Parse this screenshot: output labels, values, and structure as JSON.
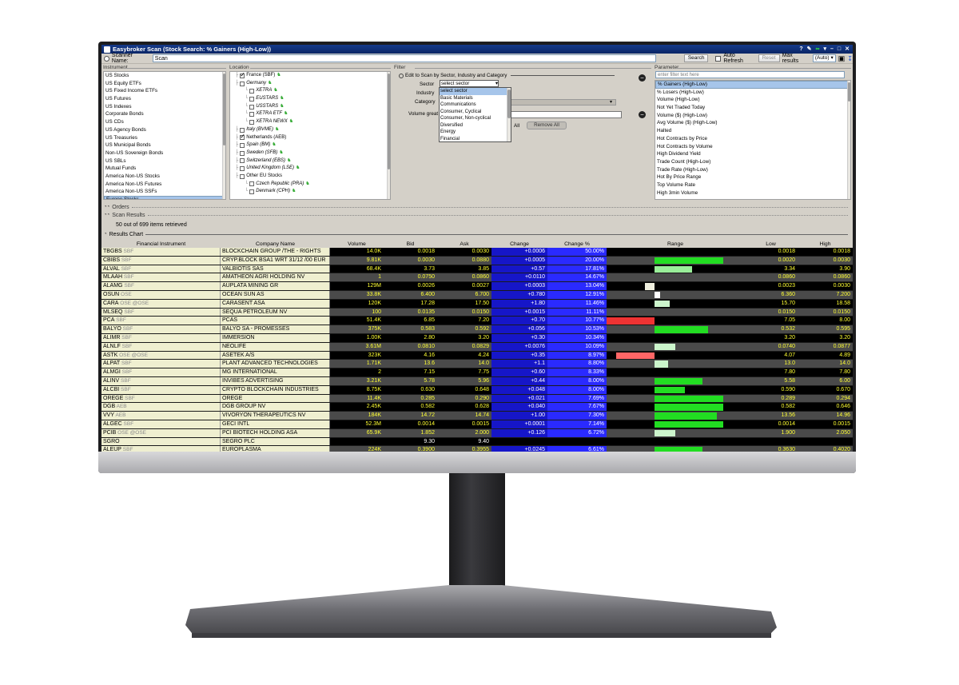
{
  "window": {
    "title": "Easybroker  Scan (Stock Search: % Gainers (High-Low))"
  },
  "scanner": {
    "label": "Scanner Name:",
    "name": "Scan",
    "search_label": "Search",
    "auto_refresh_label": "Auto Refresh",
    "reset_label": "Reset",
    "max_results_label": "Max results",
    "max_results_value": "(Auto)"
  },
  "instrument": {
    "title": "Instrument",
    "items": [
      "US Stocks",
      "US Equity ETFs",
      "US Fixed Income ETFs",
      "US Futures",
      "US Indexes",
      "Corporate Bonds",
      "US CDs",
      "US Agency Bonds",
      "US Treasuries",
      "US Municipal Bonds",
      "Non-US Sovereign Bonds",
      "US SBLs",
      "Mutual Funds",
      "America Non-US Stocks",
      "America Non-US Futures",
      "America Non-US SSFs",
      "Europe Stocks"
    ]
  },
  "location": {
    "title": "Location",
    "items": [
      {
        "label": "France (SBF)",
        "checked": true,
        "indent": 1,
        "italic": false,
        "flag": true
      },
      {
        "label": "Germany",
        "checked": false,
        "indent": 1,
        "italic": true,
        "flag": true
      },
      {
        "label": "XETRA",
        "checked": false,
        "indent": 2,
        "italic": true,
        "flag": true
      },
      {
        "label": "EUSTARS",
        "checked": false,
        "indent": 2,
        "italic": true,
        "flag": true
      },
      {
        "label": "USSTARS",
        "checked": false,
        "indent": 2,
        "italic": true,
        "flag": true
      },
      {
        "label": "XETRA ETF",
        "checked": false,
        "indent": 2,
        "italic": true,
        "flag": true
      },
      {
        "label": "XETRA NEWX",
        "checked": false,
        "indent": 2,
        "italic": true,
        "flag": true
      },
      {
        "label": "Italy (BVME)",
        "checked": false,
        "indent": 1,
        "italic": true,
        "flag": true
      },
      {
        "label": "Netherlands (AEB)",
        "checked": true,
        "indent": 1,
        "italic": false,
        "flag": false
      },
      {
        "label": "Spain (BM)",
        "checked": false,
        "indent": 1,
        "italic": true,
        "flag": true
      },
      {
        "label": "Sweden (SFB)",
        "checked": false,
        "indent": 1,
        "italic": true,
        "flag": true
      },
      {
        "label": "Switzerland (EBS)",
        "checked": false,
        "indent": 1,
        "italic": true,
        "flag": true
      },
      {
        "label": "United Kingdom (LSE)",
        "checked": false,
        "indent": 1,
        "italic": true,
        "flag": true
      },
      {
        "label": "Other EU Stocks",
        "checked": false,
        "indent": 1,
        "italic": false,
        "flag": false
      },
      {
        "label": "Czech Republic (PRA)",
        "checked": false,
        "indent": 2,
        "italic": true,
        "flag": true
      },
      {
        "label": "Denmark (CPH)",
        "checked": false,
        "indent": 2,
        "italic": true,
        "flag": true
      }
    ]
  },
  "filter": {
    "title": "Filter",
    "edit_label": "Edit to Scan by Sector, Industry and Category",
    "sector_label": "Sector",
    "industry_label": "Industry",
    "category_label": "Category",
    "volume_label": "Volume great",
    "sector_value": "select sector",
    "all_label": "All",
    "remove_all_label": "Remove All",
    "sector_options": [
      "select sector",
      "Basic Materials",
      "Communications",
      "Consumer, Cyclical",
      "Consumer, Non-cyclical",
      "Diversified",
      "Energy",
      "Financial"
    ]
  },
  "parameter": {
    "title": "Parameter",
    "placeholder": "enter filter text here",
    "items": [
      "% Gainers (High-Low)",
      "% Losers (High-Low)",
      "Volume (High-Low)",
      "Not Yet Traded Today",
      "Volume ($) (High-Low)",
      "Avg Volume ($) (High-Low)",
      "Halted",
      "Hot Contracts by Price",
      "Hot Contracts by Volume",
      "High Dividend Yield",
      "Trade Count (High-Low)",
      "Trade Rate (High-Low)",
      "Hot By Price Range",
      "Top Volume Rate",
      "High 3min Volume"
    ]
  },
  "sections": {
    "orders": "Orders",
    "scan_results": "Scan Results",
    "retrieved": "50 out of 699 items retrieved",
    "results_chart": "Results Chart"
  },
  "table": {
    "headers": [
      "Financial Instrument",
      "Company Name",
      "Volume",
      "Bid",
      "Ask",
      "Change",
      "Change %",
      "Range",
      "Low",
      "High"
    ],
    "rows": [
      {
        "sym": "TBGBS",
        "ex": "SBF",
        "co": "BLOCKCHAIN GROUP /THE - RIGHTS",
        "vol": "14.0K",
        "bid": "0.0018",
        "ask": "0.0030",
        "chg": "+0.0006",
        "pct": "50.00%",
        "low": "0.0018",
        "high": "0.0018",
        "r0": 0,
        "r1": 0,
        "rc": ""
      },
      {
        "sym": "CBIBS",
        "ex": "SBF",
        "co": "CRYP.BLOCK BSA1 WRT 31/12 /00 EUR",
        "vol": "9.81K",
        "bid": "0.0030",
        "ask": "0.0880",
        "chg": "+0.0005",
        "pct": "20.00%",
        "low": "0.0020",
        "high": "0.0030",
        "r0": 0.35,
        "r1": 0.85,
        "rc": "#22dd22"
      },
      {
        "sym": "ALVAL",
        "ex": "SBF",
        "co": "VALBIOTIS SAS",
        "vol": "68.4K",
        "bid": "3.73",
        "ask": "3.85",
        "chg": "+0.57",
        "pct": "17.81%",
        "low": "3.34",
        "high": "3.90",
        "r0": 0.35,
        "r1": 0.62,
        "rc": "#99ee99"
      },
      {
        "sym": "MLAAH",
        "ex": "SBF",
        "co": "AMATHEON AGRI HOLDING NV",
        "vol": "1",
        "bid": "0.0750",
        "ask": "0.0860",
        "chg": "+0.0110",
        "pct": "14.67%",
        "low": "0.0860",
        "high": "0.0860",
        "r0": 0,
        "r1": 0,
        "rc": ""
      },
      {
        "sym": "ALAMG",
        "ex": "SBF",
        "co": "AUPLATA MINING GR",
        "vol": "129M",
        "bid": "0.0026",
        "ask": "0.0027",
        "chg": "+0.0003",
        "pct": "13.04%",
        "low": "0.0023",
        "high": "0.0030",
        "r0": 0.28,
        "r1": 0.35,
        "rc": "#eeeedd"
      },
      {
        "sym": "OSUN",
        "ex": "OSE",
        "co": "OCEAN SUN AS",
        "vol": "33.8K",
        "bid": "6.400",
        "ask": "6.700",
        "chg": "+0.780",
        "pct": "12.91%",
        "low": "6.360",
        "high": "7.200",
        "r0": 0.35,
        "r1": 0.39,
        "rc": "#ffffff"
      },
      {
        "sym": "CARA",
        "ex": "OSE @OSE",
        "co": "CARASENT ASA",
        "vol": "120K",
        "bid": "17.28",
        "ask": "17.50",
        "chg": "+1.80",
        "pct": "11.46%",
        "low": "15.70",
        "high": "18.58",
        "r0": 0.35,
        "r1": 0.46,
        "rc": "#ccf5cc"
      },
      {
        "sym": "MLSEQ",
        "ex": "SBF",
        "co": "SEQUA PETROLEUM NV",
        "vol": "100",
        "bid": "0.0135",
        "ask": "0.0150",
        "chg": "+0.0015",
        "pct": "11.11%",
        "low": "0.0150",
        "high": "0.0150",
        "r0": 0,
        "r1": 0,
        "rc": ""
      },
      {
        "sym": "PCA",
        "ex": "SBF",
        "co": "PCAS",
        "vol": "51.4K",
        "bid": "6.85",
        "ask": "7.20",
        "chg": "+0.70",
        "pct": "10.77%",
        "low": "7.05",
        "high": "8.00",
        "r0": 0,
        "r1": 0.35,
        "rc": "#ee3333"
      },
      {
        "sym": "BALYO",
        "ex": "SBF",
        "co": "BALYO SA - PROMESSES",
        "vol": "375K",
        "bid": "0.583",
        "ask": "0.592",
        "chg": "+0.056",
        "pct": "10.53%",
        "low": "0.532",
        "high": "0.595",
        "r0": 0.35,
        "r1": 0.74,
        "rc": "#22dd22"
      },
      {
        "sym": "ALIMR",
        "ex": "SBF",
        "co": "IMMERSION",
        "vol": "1.00K",
        "bid": "2.80",
        "ask": "3.20",
        "chg": "+0.30",
        "pct": "10.34%",
        "low": "3.20",
        "high": "3.20",
        "r0": 0,
        "r1": 0,
        "rc": ""
      },
      {
        "sym": "ALNLF",
        "ex": "SBF",
        "co": "NEOLIFE",
        "vol": "3.61M",
        "bid": "0.0810",
        "ask": "0.0829",
        "chg": "+0.0076",
        "pct": "10.09%",
        "low": "0.0740",
        "high": "0.0877",
        "r0": 0.35,
        "r1": 0.5,
        "rc": "#ccf5cc"
      },
      {
        "sym": "ASTK",
        "ex": "OSE @OSE",
        "co": "ASETEK A/S",
        "vol": "323K",
        "bid": "4.16",
        "ask": "4.24",
        "chg": "+0.35",
        "pct": "8.97%",
        "low": "4.07",
        "high": "4.89",
        "r0": 0.07,
        "r1": 0.35,
        "rc": "#ff6666"
      },
      {
        "sym": "ALPAT",
        "ex": "SBF",
        "co": "PLANT ADVANCED TECHNOLOGIES",
        "vol": "1.71K",
        "bid": "13.6",
        "ask": "14.0",
        "chg": "+1.1",
        "pct": "8.80%",
        "low": "13.0",
        "high": "14.0",
        "r0": 0.35,
        "r1": 0.45,
        "rc": "#ccf5cc"
      },
      {
        "sym": "ALMGI",
        "ex": "SBF",
        "co": "MG INTERNATIONAL",
        "vol": "2",
        "bid": "7.15",
        "ask": "7.75",
        "chg": "+0.60",
        "pct": "8.33%",
        "low": "7.80",
        "high": "7.80",
        "r0": 0,
        "r1": 0,
        "rc": ""
      },
      {
        "sym": "ALINV",
        "ex": "SBF",
        "co": "INVIBES ADVERTISING",
        "vol": "3.21K",
        "bid": "5.78",
        "ask": "5.96",
        "chg": "+0.44",
        "pct": "8.00%",
        "low": "5.58",
        "high": "6.00",
        "r0": 0.35,
        "r1": 0.7,
        "rc": "#22dd22"
      },
      {
        "sym": "ALCBI",
        "ex": "SBF",
        "co": "CRYPTO BLOCKCHAIN INDUSTRIES",
        "vol": "8.75K",
        "bid": "0.630",
        "ask": "0.648",
        "chg": "+0.048",
        "pct": "8.00%",
        "low": "0.590",
        "high": "0.670",
        "r0": 0.35,
        "r1": 0.57,
        "rc": "#22dd22"
      },
      {
        "sym": "OREGE",
        "ex": "SBF",
        "co": "OREGE",
        "vol": "11.4K",
        "bid": "0.285",
        "ask": "0.290",
        "chg": "+0.021",
        "pct": "7.69%",
        "low": "0.289",
        "high": "0.294",
        "r0": 0.35,
        "r1": 0.85,
        "rc": "#22dd22"
      },
      {
        "sym": "DGB",
        "ex": "AEB",
        "co": "DGB GROUP NV",
        "vol": "2.45K",
        "bid": "0.582",
        "ask": "0.628",
        "chg": "+0.040",
        "pct": "7.67%",
        "low": "0.582",
        "high": "0.646",
        "r0": 0.35,
        "r1": 0.85,
        "rc": "#22dd22"
      },
      {
        "sym": "VVY",
        "ex": "AEB",
        "co": "VIVORYON THERAPEUTICS NV",
        "vol": "184K",
        "bid": "14.72",
        "ask": "14.74",
        "chg": "+1.00",
        "pct": "7.30%",
        "low": "13.56",
        "high": "14.96",
        "r0": 0.35,
        "r1": 0.8,
        "rc": "#22dd22"
      },
      {
        "sym": "ALGEC",
        "ex": "SBF",
        "co": "GECI INTL",
        "vol": "52.3M",
        "bid": "0.0014",
        "ask": "0.0015",
        "chg": "+0.0001",
        "pct": "7.14%",
        "low": "0.0014",
        "high": "0.0015",
        "r0": 0.35,
        "r1": 0.85,
        "rc": "#22dd22"
      },
      {
        "sym": "PCIB",
        "ex": "OSE @OSE",
        "co": "PCI BIOTECH HOLDING ASA",
        "vol": "65.9K",
        "bid": "1.852",
        "ask": "2.000",
        "chg": "+0.126",
        "pct": "6.72%",
        "low": "1.900",
        "high": "2.050",
        "r0": 0.35,
        "r1": 0.5,
        "rc": "#ccf5cc"
      },
      {
        "sym": "SGRO",
        "ex": "",
        "co": "SEGRO PLC",
        "vol": "",
        "bid": "9.30",
        "ask": "9.40",
        "chg": "",
        "pct": "",
        "low": "",
        "high": "",
        "r0": 0,
        "r1": 0,
        "rc": ""
      },
      {
        "sym": "ALEUP",
        "ex": "SBF",
        "co": "EUROPLASMA",
        "vol": "224K",
        "bid": "0.3900",
        "ask": "0.3955",
        "chg": "+0.0245",
        "pct": "6.61%",
        "low": "0.3630",
        "high": "0.4020",
        "r0": 0.35,
        "r1": 0.7,
        "rc": "#22dd22"
      }
    ]
  }
}
